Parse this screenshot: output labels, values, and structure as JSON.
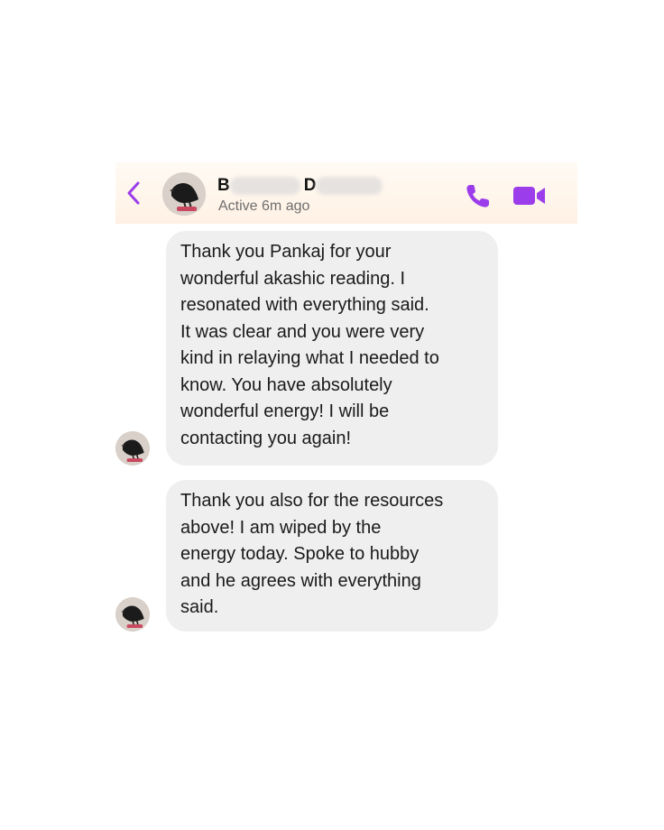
{
  "header": {
    "back_icon": "chevron-left-icon",
    "contact_name_first_initial": "B",
    "contact_name_last_initial": "D",
    "active_status": "Active 6m ago",
    "call_icon": "phone-icon",
    "video_icon": "video-camera-icon"
  },
  "messages": [
    {
      "text": "Thank you Pankaj for your\nwonderful akashic reading.  I\nresonated with everything said.\nIt was clear and you were very\nkind in relaying what I needed to\nknow.  You have absolutely\nwonderful energy!  I will be\ncontacting you again!"
    },
    {
      "text": "Thank you also for the resources\nabove!  I am wiped by the\nenergy today.  Spoke to hubby\nand he agrees with everything\nsaid."
    }
  ],
  "colors": {
    "accent": "#9b3dea",
    "bubble_background": "#efefef",
    "header_background": "#fff5ea"
  }
}
